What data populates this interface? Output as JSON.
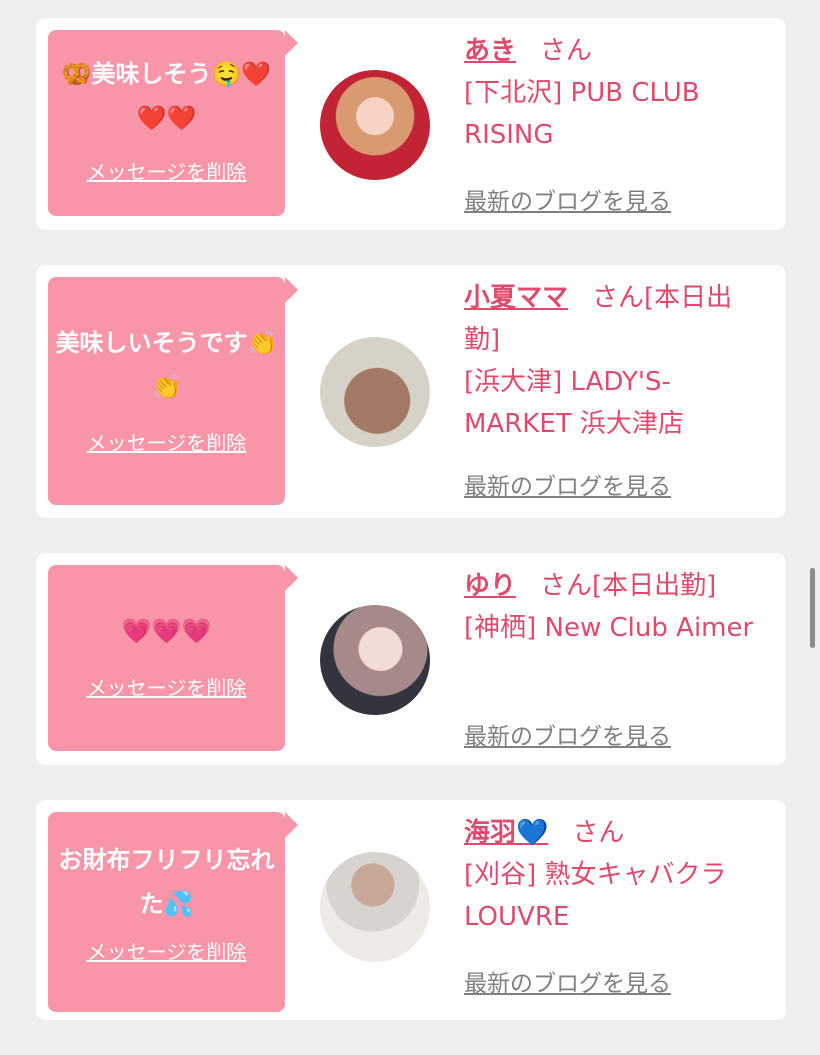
{
  "messages": [
    {
      "text": "🥨美味しそう🤤❤️❤️❤️",
      "delete_label": "メッセージを削除",
      "name": "あき",
      "suffix": "さん",
      "shop": "[下北沢] PUB CLUB RISING",
      "blog_label": "最新のブログを見る"
    },
    {
      "text": "美味しいそうです👏👏",
      "delete_label": "メッセージを削除",
      "name": "小夏ママ",
      "suffix": "さん[本日出勤]",
      "shop": "[浜大津] LADY'S-MARKET 浜大津店",
      "blog_label": "最新のブログを見る"
    },
    {
      "text": "💗💗💗",
      "delete_label": "メッセージを削除",
      "name": "ゆり",
      "suffix": "さん[本日出勤]",
      "shop": "[神栖] New Club Aimer",
      "blog_label": "最新のブログを見る"
    },
    {
      "text": "お財布フリフリ忘れた💦",
      "delete_label": "メッセージを削除",
      "name": "海羽💙",
      "suffix": "さん",
      "shop": "[刈谷] 熟女キャバクラ LOUVRE",
      "blog_label": "最新のブログを見る"
    }
  ],
  "colors": {
    "bubble": "#f995a8",
    "accent_text": "#e04a6c",
    "blog_link": "#808080",
    "background": "#efefef"
  }
}
